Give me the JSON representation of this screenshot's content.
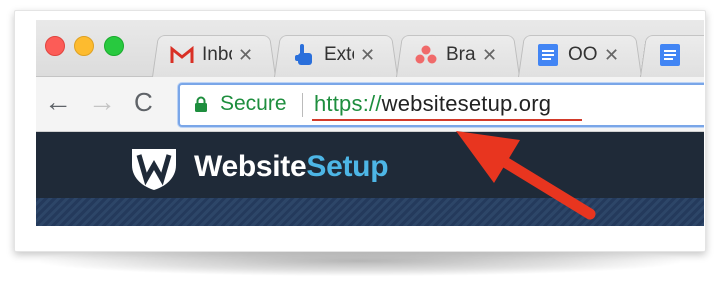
{
  "window": {
    "controls": [
      "close",
      "minimize",
      "maximize"
    ]
  },
  "tabs": [
    {
      "label": "Inbox",
      "icon": "gmail-icon",
      "close": "✕"
    },
    {
      "label": "Extensions",
      "icon": "hand-pointer-icon",
      "close": "✕"
    },
    {
      "label": "Brand",
      "icon": "asana-icon",
      "close": "✕"
    },
    {
      "label": "OOO",
      "icon": "docs-icon",
      "close": "✕"
    },
    {
      "label": "",
      "icon": "docs-icon"
    }
  ],
  "toolbar": {
    "back": "←",
    "forward": "→",
    "reload": "C"
  },
  "omnibox": {
    "security_label": "Secure",
    "url_scheme": "https://",
    "url_host": "websitesetup.org"
  },
  "site": {
    "logo_part1": "Website",
    "logo_part2": "Setup"
  },
  "colors": {
    "secure_green": "#1e8e3e",
    "annotation_red": "#e8351f",
    "header_bg": "#1f2a38",
    "logo_accent": "#4db6e6"
  }
}
